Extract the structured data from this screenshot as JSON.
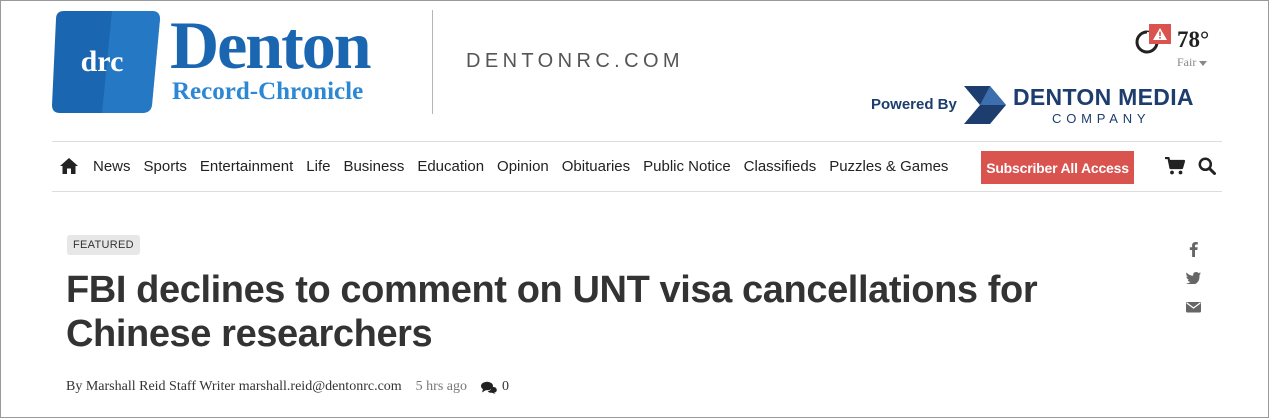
{
  "header": {
    "logo_abbrev": "drc",
    "logo_name": "Denton",
    "logo_subtitle": "Record-Chronicle",
    "site_url": "DENTONRC.COM"
  },
  "weather": {
    "temperature": "78°",
    "condition": "Fair",
    "alert_symbol": "!"
  },
  "powered_by": {
    "label": "Powered By",
    "company_name": "DENTON MEDIA",
    "company_suffix": "COMPANY"
  },
  "nav": {
    "home_icon": "home-icon",
    "items": [
      {
        "label": "News"
      },
      {
        "label": "Sports"
      },
      {
        "label": "Entertainment"
      },
      {
        "label": "Life"
      },
      {
        "label": "Business"
      },
      {
        "label": "Education"
      },
      {
        "label": "Opinion"
      },
      {
        "label": "Obituaries"
      },
      {
        "label": "Public Notice"
      },
      {
        "label": "Classifieds"
      },
      {
        "label": "Puzzles & Games"
      }
    ],
    "subscriber_button": "Subscriber All Access",
    "cart_icon": "cart-icon",
    "search_icon": "search-icon"
  },
  "article": {
    "badge": "FEATURED",
    "headline": "FBI declines to comment on UNT visa cancellations for Chinese researchers",
    "byline": "By Marshall Reid Staff Writer marshall.reid@dentonrc.com",
    "time_ago": "5 hrs ago",
    "comment_count": "0"
  },
  "share": {
    "icons": [
      "facebook-icon",
      "twitter-icon",
      "email-icon"
    ]
  },
  "colors": {
    "brand_blue": "#1b66b1",
    "brand_light_blue": "#2c87d4",
    "navy": "#1d3d6e",
    "accent_red": "#d9534f"
  }
}
